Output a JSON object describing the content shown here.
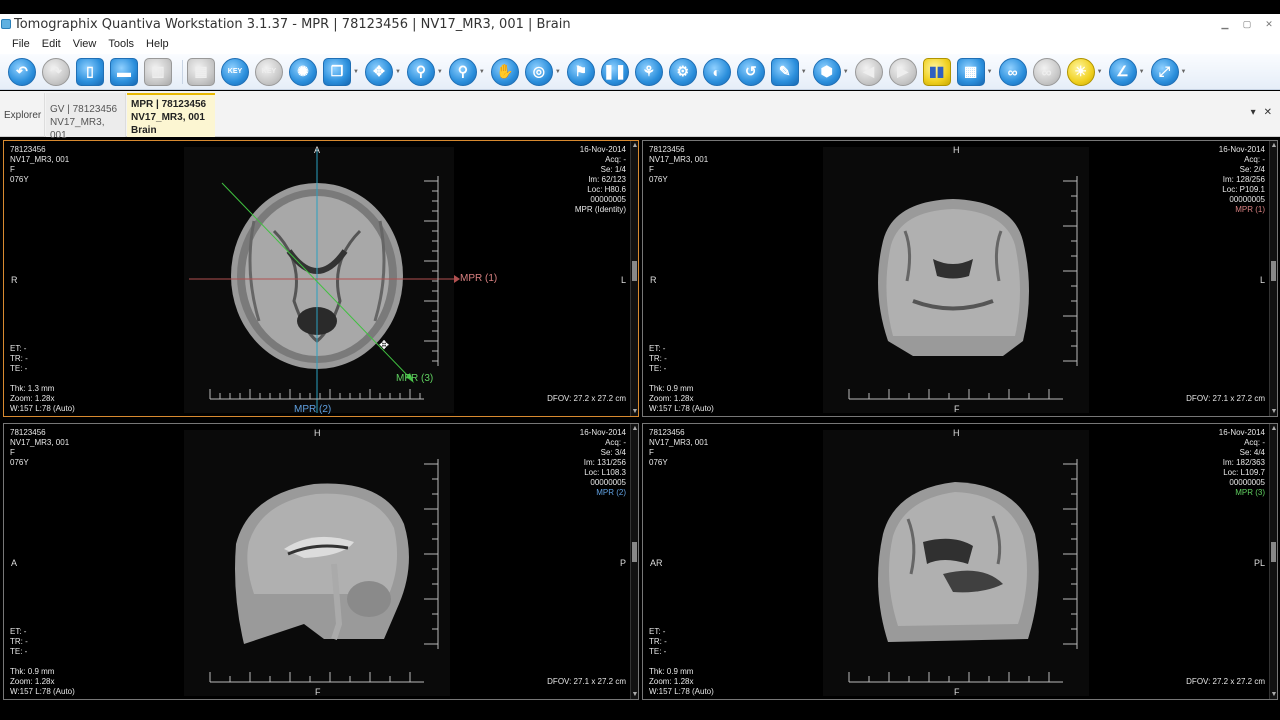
{
  "window": {
    "title": "Tomographix Quantiva Workstation 3.1.37 - MPR | 78123456 | NV17_MR3, 001 | Brain",
    "controls": [
      "▁",
      "▢",
      "✕"
    ]
  },
  "menu": [
    "File",
    "Edit",
    "View",
    "Tools",
    "Help"
  ],
  "tabs": {
    "explorer": "Explorer",
    "gv_line1": "GV | 78123456",
    "gv_line2": "NV17_MR3, 001",
    "active_line1": "MPR | 78123456",
    "active_line2": "NV17_MR3, 001",
    "active_line3": "Brain",
    "pin": "▾",
    "close": "✕"
  },
  "viewports": [
    {
      "id": "axial",
      "patient_id": "78123456",
      "series_name": "NV17_MR3, 001",
      "sex": "F",
      "age": "076Y",
      "date": "16-Nov-2014",
      "acq": "Acq: -",
      "se": "Se: 1/4",
      "im": "Im: 62/123",
      "loc": "Loc: H80.6",
      "code": "00000005",
      "view_label": "MPR (Identity)",
      "et": "ET: -",
      "tr": "TR: -",
      "te": "TE: -",
      "thk": "Thk: 1.3 mm",
      "zoom": "Zoom: 1.28x",
      "wl": "W:157 L:78 (Auto)",
      "dfov": "DFOV: 27.2 x 27.2 cm",
      "top": "A",
      "bottom": "",
      "left": "R",
      "right": "L",
      "mpr1": "MPR (1)",
      "mpr2": "MPR (2)",
      "mpr3": "MPR (3)"
    },
    {
      "id": "coronal",
      "patient_id": "78123456",
      "series_name": "NV17_MR3, 001",
      "sex": "F",
      "age": "076Y",
      "date": "16-Nov-2014",
      "acq": "Acq: -",
      "se": "Se: 2/4",
      "im": "Im: 128/256",
      "loc": "Loc: P109.1",
      "code": "00000005",
      "view_label": "MPR (1)",
      "et": "ET: -",
      "tr": "TR: -",
      "te": "TE: -",
      "thk": "Thk: 0.9 mm",
      "zoom": "Zoom: 1.28x",
      "wl": "W:157 L:78 (Auto)",
      "dfov": "DFOV: 27.1 x 27.2 cm",
      "top": "H",
      "bottom": "F",
      "left": "R",
      "right": "L"
    },
    {
      "id": "sagittal",
      "patient_id": "78123456",
      "series_name": "NV17_MR3, 001",
      "sex": "F",
      "age": "076Y",
      "date": "16-Nov-2014",
      "acq": "Acq: -",
      "se": "Se: 3/4",
      "im": "Im: 131/256",
      "loc": "Loc: L108.3",
      "code": "00000005",
      "view_label": "MPR (2)",
      "et": "ET: -",
      "tr": "TR: -",
      "te": "TE: -",
      "thk": "Thk: 0.9 mm",
      "zoom": "Zoom: 1.28x",
      "wl": "W:157 L:78 (Auto)",
      "dfov": "DFOV: 27.1 x 27.2 cm",
      "top": "H",
      "bottom": "F",
      "left": "A",
      "right": "P"
    },
    {
      "id": "oblique",
      "patient_id": "78123456",
      "series_name": "NV17_MR3, 001",
      "sex": "F",
      "age": "076Y",
      "date": "16-Nov-2014",
      "acq": "Acq: -",
      "se": "Se: 4/4",
      "im": "Im: 182/363",
      "loc": "Loc: L109.7",
      "code": "00000005",
      "view_label": "MPR (3)",
      "et": "ET: -",
      "tr": "TR: -",
      "te": "TE: -",
      "thk": "Thk: 0.9 mm",
      "zoom": "Zoom: 1.28x",
      "wl": "W:157 L:78 (Auto)",
      "dfov": "DFOV: 27.2 x 27.2 cm",
      "top": "H",
      "bottom": "F",
      "left": "AR",
      "right": "PL"
    }
  ],
  "colors": {
    "mpr1": "#d88080",
    "mpr2": "#60a0e0",
    "mpr3": "#60d060",
    "active_border": "#d88a30"
  },
  "toolbar_icons": [
    "undo-icon",
    "redo-icon",
    "clipboard-icon",
    "layout-icon",
    "series-layout-icon",
    "grid-icon",
    "key-image-icon",
    "key-filter-icon",
    "cine-icon",
    "stack-icon",
    "pan-zoom-icon",
    "magnifier-icon",
    "zoom-region-icon",
    "hand-icon",
    "target-icon",
    "probe-icon",
    "pairs-icon",
    "link-icon",
    "sync-icon",
    "invert-icon",
    "rotate-icon",
    "annotation-icon",
    "capture-icon",
    "prev-icon",
    "next-icon",
    "film-icon",
    "color-map-icon",
    "glasses-icon",
    "network-icon",
    "light-icon",
    "angle-icon",
    "measure-icon"
  ]
}
